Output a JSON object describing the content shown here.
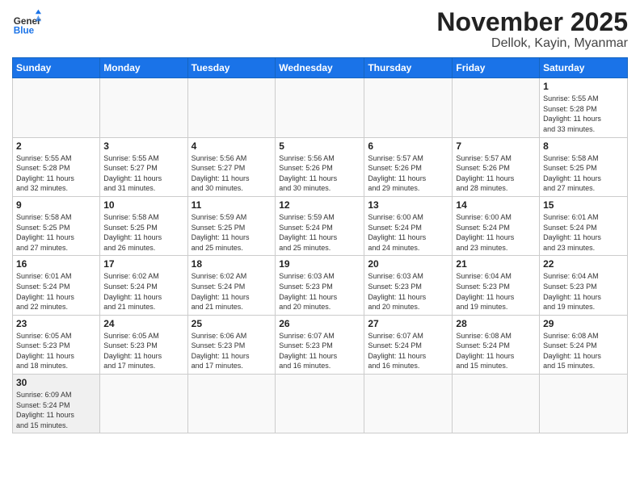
{
  "logo": {
    "text_general": "General",
    "text_blue": "Blue"
  },
  "header": {
    "month": "November 2025",
    "location": "Dellok, Kayin, Myanmar"
  },
  "weekdays": [
    "Sunday",
    "Monday",
    "Tuesday",
    "Wednesday",
    "Thursday",
    "Friday",
    "Saturday"
  ],
  "weeks": [
    [
      {
        "day": "",
        "info": ""
      },
      {
        "day": "",
        "info": ""
      },
      {
        "day": "",
        "info": ""
      },
      {
        "day": "",
        "info": ""
      },
      {
        "day": "",
        "info": ""
      },
      {
        "day": "",
        "info": ""
      },
      {
        "day": "1",
        "info": "Sunrise: 5:55 AM\nSunset: 5:28 PM\nDaylight: 11 hours\nand 33 minutes."
      }
    ],
    [
      {
        "day": "2",
        "info": "Sunrise: 5:55 AM\nSunset: 5:28 PM\nDaylight: 11 hours\nand 32 minutes."
      },
      {
        "day": "3",
        "info": "Sunrise: 5:55 AM\nSunset: 5:27 PM\nDaylight: 11 hours\nand 31 minutes."
      },
      {
        "day": "4",
        "info": "Sunrise: 5:56 AM\nSunset: 5:27 PM\nDaylight: 11 hours\nand 30 minutes."
      },
      {
        "day": "5",
        "info": "Sunrise: 5:56 AM\nSunset: 5:26 PM\nDaylight: 11 hours\nand 30 minutes."
      },
      {
        "day": "6",
        "info": "Sunrise: 5:57 AM\nSunset: 5:26 PM\nDaylight: 11 hours\nand 29 minutes."
      },
      {
        "day": "7",
        "info": "Sunrise: 5:57 AM\nSunset: 5:26 PM\nDaylight: 11 hours\nand 28 minutes."
      },
      {
        "day": "8",
        "info": "Sunrise: 5:58 AM\nSunset: 5:25 PM\nDaylight: 11 hours\nand 27 minutes."
      }
    ],
    [
      {
        "day": "9",
        "info": "Sunrise: 5:58 AM\nSunset: 5:25 PM\nDaylight: 11 hours\nand 27 minutes."
      },
      {
        "day": "10",
        "info": "Sunrise: 5:58 AM\nSunset: 5:25 PM\nDaylight: 11 hours\nand 26 minutes."
      },
      {
        "day": "11",
        "info": "Sunrise: 5:59 AM\nSunset: 5:25 PM\nDaylight: 11 hours\nand 25 minutes."
      },
      {
        "day": "12",
        "info": "Sunrise: 5:59 AM\nSunset: 5:24 PM\nDaylight: 11 hours\nand 25 minutes."
      },
      {
        "day": "13",
        "info": "Sunrise: 6:00 AM\nSunset: 5:24 PM\nDaylight: 11 hours\nand 24 minutes."
      },
      {
        "day": "14",
        "info": "Sunrise: 6:00 AM\nSunset: 5:24 PM\nDaylight: 11 hours\nand 23 minutes."
      },
      {
        "day": "15",
        "info": "Sunrise: 6:01 AM\nSunset: 5:24 PM\nDaylight: 11 hours\nand 23 minutes."
      }
    ],
    [
      {
        "day": "16",
        "info": "Sunrise: 6:01 AM\nSunset: 5:24 PM\nDaylight: 11 hours\nand 22 minutes."
      },
      {
        "day": "17",
        "info": "Sunrise: 6:02 AM\nSunset: 5:24 PM\nDaylight: 11 hours\nand 21 minutes."
      },
      {
        "day": "18",
        "info": "Sunrise: 6:02 AM\nSunset: 5:24 PM\nDaylight: 11 hours\nand 21 minutes."
      },
      {
        "day": "19",
        "info": "Sunrise: 6:03 AM\nSunset: 5:23 PM\nDaylight: 11 hours\nand 20 minutes."
      },
      {
        "day": "20",
        "info": "Sunrise: 6:03 AM\nSunset: 5:23 PM\nDaylight: 11 hours\nand 20 minutes."
      },
      {
        "day": "21",
        "info": "Sunrise: 6:04 AM\nSunset: 5:23 PM\nDaylight: 11 hours\nand 19 minutes."
      },
      {
        "day": "22",
        "info": "Sunrise: 6:04 AM\nSunset: 5:23 PM\nDaylight: 11 hours\nand 19 minutes."
      }
    ],
    [
      {
        "day": "23",
        "info": "Sunrise: 6:05 AM\nSunset: 5:23 PM\nDaylight: 11 hours\nand 18 minutes."
      },
      {
        "day": "24",
        "info": "Sunrise: 6:05 AM\nSunset: 5:23 PM\nDaylight: 11 hours\nand 17 minutes."
      },
      {
        "day": "25",
        "info": "Sunrise: 6:06 AM\nSunset: 5:23 PM\nDaylight: 11 hours\nand 17 minutes."
      },
      {
        "day": "26",
        "info": "Sunrise: 6:07 AM\nSunset: 5:23 PM\nDaylight: 11 hours\nand 16 minutes."
      },
      {
        "day": "27",
        "info": "Sunrise: 6:07 AM\nSunset: 5:24 PM\nDaylight: 11 hours\nand 16 minutes."
      },
      {
        "day": "28",
        "info": "Sunrise: 6:08 AM\nSunset: 5:24 PM\nDaylight: 11 hours\nand 15 minutes."
      },
      {
        "day": "29",
        "info": "Sunrise: 6:08 AM\nSunset: 5:24 PM\nDaylight: 11 hours\nand 15 minutes."
      }
    ],
    [
      {
        "day": "30",
        "info": "Sunrise: 6:09 AM\nSunset: 5:24 PM\nDaylight: 11 hours\nand 15 minutes."
      },
      {
        "day": "",
        "info": ""
      },
      {
        "day": "",
        "info": ""
      },
      {
        "day": "",
        "info": ""
      },
      {
        "day": "",
        "info": ""
      },
      {
        "day": "",
        "info": ""
      },
      {
        "day": "",
        "info": ""
      }
    ]
  ]
}
